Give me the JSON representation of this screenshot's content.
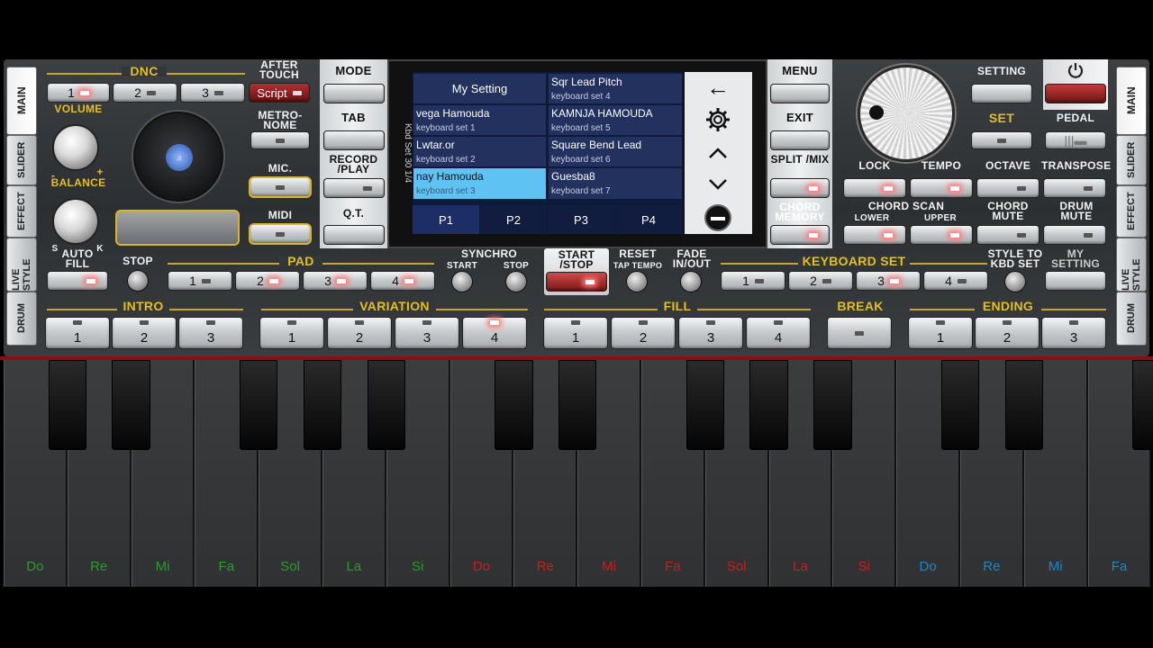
{
  "side_tabs_left": [
    "MAIN",
    "SLIDER",
    "EFFECT",
    "LIVE STYLE",
    "DRUM"
  ],
  "side_tabs_right": [
    "MAIN",
    "SLIDER",
    "EFFECT",
    "LIVE STYLE",
    "DRUM"
  ],
  "dnc": {
    "label": "DNC",
    "buttons": [
      "1",
      "2",
      "3"
    ],
    "aftertouch_label": "AFTER TOUCH",
    "script_label": "Script"
  },
  "volume_label": "VOLUME",
  "balance_label": "BALANCE",
  "balance_left": "S",
  "balance_right": "K",
  "knob_minus": "-",
  "knob_plus": "+",
  "metronome_label": "METRO-NOME",
  "mic_label": "MIC.",
  "midi_label": "MIDI",
  "mode_label": "MODE",
  "tab_label": "TAB",
  "record_label": "RECORD /PLAY",
  "qt_label": "Q.T.",
  "menu_label": "MENU",
  "exit_label": "EXIT",
  "split_label": "SPLIT /MIX",
  "chord_memory_label": "CHORD MEMORY",
  "setting_label": "SETTING",
  "set_label": "SET",
  "pedal_label": "PEDAL",
  "power_icon": "power-icon",
  "lock_label": "LOCK",
  "tempo_label": "TEMPO",
  "octave_label": "OCTAVE",
  "transpose_label": "TRANSPOSE",
  "chord_scan_label": "CHORD SCAN",
  "lower_label": "LOWER",
  "upper_label": "UPPER",
  "chord_mute_label": "CHORD MUTE",
  "drum_mute_label": "DRUM MUTE",
  "screen": {
    "side_text": "Kbd Set 30 1/4",
    "items": [
      {
        "title": "My Setting",
        "sub": ""
      },
      {
        "title": "Sqr Lead Pitch",
        "sub": "keyboard set 4"
      },
      {
        "title": "vega Hamouda",
        "sub": "keyboard set 1"
      },
      {
        "title": "KAMNJA HAMOUDA",
        "sub": "keyboard set 5"
      },
      {
        "title": "Lwtar.or",
        "sub": "keyboard set 2"
      },
      {
        "title": "Square Bend Lead",
        "sub": "keyboard set 6"
      },
      {
        "title": "nay Hamouda",
        "sub": "keyboard set 3"
      },
      {
        "title": "Guesba8",
        "sub": "keyboard set 7"
      }
    ],
    "pages": [
      "P1",
      "P2",
      "P3",
      "P4"
    ],
    "selected_page": "P1"
  },
  "auto_fill_label": "AUTO FILL",
  "stop_label": "STOP",
  "pad_label": "PAD",
  "pad_buttons": [
    "1",
    "2",
    "3",
    "4"
  ],
  "synchro_label": "SYNCHRO",
  "synchro_start": "START",
  "synchro_stop": "STOP",
  "start_stop_label": "START /STOP",
  "reset_label": "RESET",
  "tap_tempo_label": "TAP TEMPO",
  "fade_label": "FADE IN/OUT",
  "keyboard_set_label": "KEYBOARD SET",
  "keyboard_set_buttons": [
    "1",
    "2",
    "3",
    "4"
  ],
  "style_to_kbd_label": "STYLE TO KBD SET",
  "my_setting_label": "MY SETTING",
  "intro": {
    "label": "INTRO",
    "buttons": [
      "1",
      "2",
      "3"
    ]
  },
  "variation": {
    "label": "VARIATION",
    "buttons": [
      "1",
      "2",
      "3",
      "4"
    ]
  },
  "fill": {
    "label": "FILL",
    "buttons": [
      "1",
      "2",
      "3",
      "4"
    ]
  },
  "break_label": "BREAK",
  "ending": {
    "label": "ENDING",
    "buttons": [
      "1",
      "2",
      "3"
    ]
  },
  "keys": [
    {
      "note": "Do",
      "color": "#2e9a2e"
    },
    {
      "note": "Re",
      "color": "#2e9a2e"
    },
    {
      "note": "Mi",
      "color": "#2e9a2e"
    },
    {
      "note": "Fa",
      "color": "#2e9a2e"
    },
    {
      "note": "Sol",
      "color": "#2e9a2e"
    },
    {
      "note": "La",
      "color": "#2e9a2e"
    },
    {
      "note": "Si",
      "color": "#2e9a2e"
    },
    {
      "note": "Do",
      "color": "#c81e1e"
    },
    {
      "note": "Re",
      "color": "#c81e1e"
    },
    {
      "note": "Mi",
      "color": "#c81e1e"
    },
    {
      "note": "Fa",
      "color": "#c81e1e"
    },
    {
      "note": "Sol",
      "color": "#c81e1e"
    },
    {
      "note": "La",
      "color": "#c81e1e"
    },
    {
      "note": "Si",
      "color": "#c81e1e"
    },
    {
      "note": "Do",
      "color": "#1d86c6"
    },
    {
      "note": "Re",
      "color": "#1d86c6"
    },
    {
      "note": "Mi",
      "color": "#1d86c6"
    },
    {
      "note": "Fa",
      "color": "#1d86c6"
    }
  ]
}
